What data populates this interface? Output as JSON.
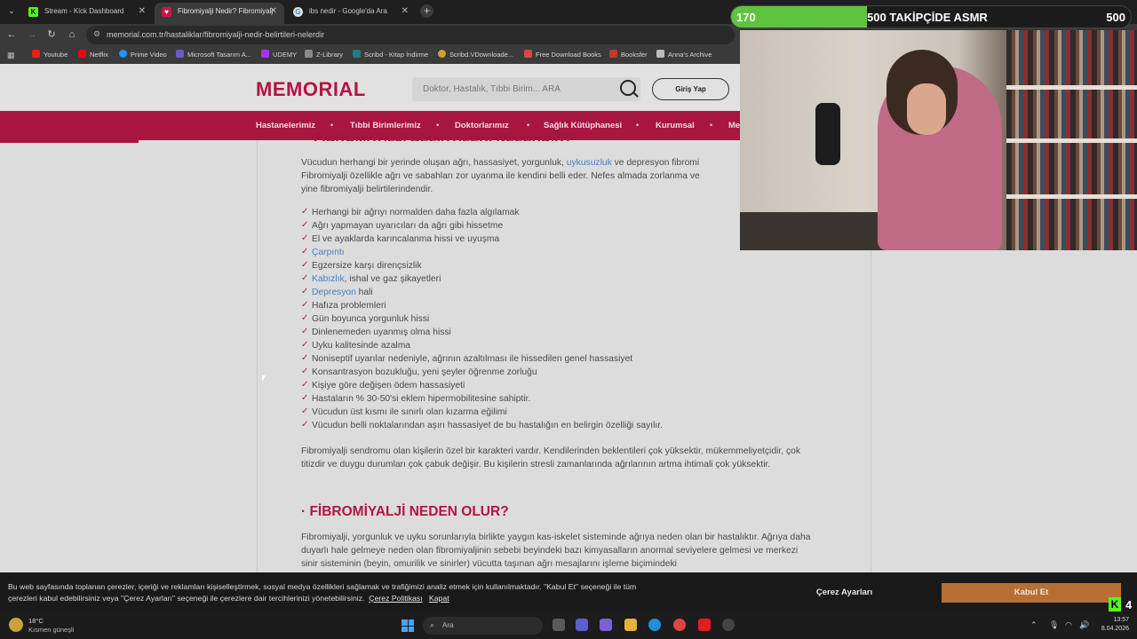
{
  "browser": {
    "tabs": [
      {
        "title": "Stream - Kick Dashboard",
        "favicon": "kick-icon",
        "color": "#53fc18",
        "active": false
      },
      {
        "title": "Fibromiyalji Nedir? Fibromiyalj",
        "favicon": "memorial-icon",
        "color": "#c8174a",
        "active": true
      },
      {
        "title": "ibs nedir - Google'da Ara",
        "favicon": "google-icon",
        "color": "#e0e0e0",
        "active": false
      }
    ],
    "url": "memorial.com.tr/hastaliklar/fibromiyalji-nedir-belirtileri-nelerdir",
    "bookmarks": [
      {
        "label": "Youtube",
        "color": "#e62117"
      },
      {
        "label": "Netflix",
        "color": "#e50914"
      },
      {
        "label": "Prime Video",
        "color": "#1a98ff"
      },
      {
        "label": "Microsoft Tasarım A...",
        "color": "#6a5acd"
      },
      {
        "label": "UDEMY",
        "color": "#a435f0"
      },
      {
        "label": "Z-Library",
        "color": "#888888"
      },
      {
        "label": "Scribd - Kitap İndirme",
        "color": "#1e7b85"
      },
      {
        "label": "Scribd.VDownloade...",
        "color": "#d0a030"
      },
      {
        "label": "Free Download Books",
        "color": "#d44"
      },
      {
        "label": "Booksfer",
        "color": "#c0392b"
      },
      {
        "label": "Anna's Archive",
        "color": "#bbbbbb"
      }
    ]
  },
  "site": {
    "logo": "MEMORIAL",
    "search_placeholder": "Doktor, Hastalık, Tıbbi Birim... ARA",
    "login": "Giriş Yap",
    "brand_color": "#b31544",
    "nav": [
      "Hastanelerimiz",
      "Tıbbi Birimlerimiz",
      "Doktorlarımız",
      "Sağlık Kütüphanesi",
      "Kurumsal",
      "Me"
    ],
    "cut_heading": "· FİBROMİYALJİ BELİRTİLERİ NELERDİR?",
    "intro": {
      "before_link": "Vücudun herhangi bir yerinde oluşan ağrı, hassasiyet, yorgunluk, ",
      "link": "uykusuzluk",
      "after_link": " ve depresyon fibromi",
      "line2": "Fibromiyalji özellikle ağrı ve sabahları zor uyanma ile kendini belli eder. Nefes almada zorlanma ve",
      "line3": "yine fibromiyalji belirtilerindendir."
    },
    "symptoms": [
      {
        "text": "Herhangi bir ağrıyı normalden daha fazla algılamak",
        "link": "",
        "rest": ""
      },
      {
        "text": "Ağrı yapmayan uyarıcıları da ağrı gibi hissetme",
        "link": "",
        "rest": ""
      },
      {
        "text": "El ve ayaklarda karıncalanma hissi ve uyuşma",
        "link": "",
        "rest": ""
      },
      {
        "text": "",
        "link": "Çarpıntı",
        "rest": ""
      },
      {
        "text": "Egzersize karşı dirençsizlik",
        "link": "",
        "rest": ""
      },
      {
        "text": "",
        "link": "Kabızlık",
        "rest": ", ishal ve gaz şikayetleri"
      },
      {
        "text": "",
        "link": "Depresyon",
        "rest": " hali"
      },
      {
        "text": "Hafıza problemleri",
        "link": "",
        "rest": ""
      },
      {
        "text": "Gün boyunca yorgunluk hissi",
        "link": "",
        "rest": ""
      },
      {
        "text": "Dinlenemeden uyanmış olma hissi",
        "link": "",
        "rest": ""
      },
      {
        "text": "Uyku kalitesinde azalma",
        "link": "",
        "rest": ""
      },
      {
        "text": "Noniseptif uyarılar nedeniyle, ağrının azaltılması ile hissedilen genel hassasiyet",
        "link": "",
        "rest": ""
      },
      {
        "text": "Konsantrasyon bozukluğu, yeni şeyler öğrenme zorluğu",
        "link": "",
        "rest": ""
      },
      {
        "text": "Kişiye göre değişen ödem hassasiyeti",
        "link": "",
        "rest": ""
      },
      {
        "text": "Hastaların % 30-50'si eklem hipermobilitesine sahiptir.",
        "link": "",
        "rest": ""
      },
      {
        "text": "Vücudun üst kısmı ile sınırlı olan kızarma eğilimi",
        "link": "",
        "rest": ""
      },
      {
        "text": "Vücudun belli noktalarından aşırı hassasiyet de bu hastalığın en belirgin özelliği sayılır.",
        "link": "",
        "rest": ""
      }
    ],
    "character_para": "Fibromiyalji sendromu olan kişilerin özel bir karakteri vardır. Kendilerinden beklentileri çok yüksektir, mükemmeliyetçidir, çok titizdir ve duygu durumları çok çabuk değişir. Bu kişilerin stresli zamanlarında ağrılarının artma ihtimali çok yüksektir.",
    "heading2": "· FİBROMİYALJİ NEDEN OLUR?",
    "cause_para": "Fibromiyalji, yorgunluk ve uyku sorunlarıyla birlikte yaygın kas-iskelet sisteminde ağrıya neden olan bir hastalıktır. Ağrıya daha duyarlı hale gelmeye neden olan fibromiyaljinin sebebi beyindeki bazı kimyasalların anormal seviyelere gelmesi ve merkezi sinir sisteminin (beyin, omurilik ve sinirler) vücutta taşınan ağrı mesajlarını işleme biçimindeki"
  },
  "cookie": {
    "text_line1": "Bu web sayfasında toplanan çerezler, içeriği ve reklamları kişiselleştirmek, sosyal medya özellikleri sağlamak ve trafiğimizi analiz etmek için kullanılmaktadır. \"Kabul Et\" seçeneği ile tüm",
    "text_line2": "çerezleri kabul edebilirsiniz veya \"Çerez Ayarları\" seçeneği ile çerezlere dair tercihlerinizi yönetebilirsiniz.",
    "policy_link": "Çerez Politikası",
    "close_link": "Kapat",
    "settings": "Çerez Ayarları",
    "accept": "Kabul Et"
  },
  "overlay": {
    "current": "170",
    "title": "500 TAKİPÇİDE ASMR",
    "goal": "500",
    "progress": 0.34,
    "kick_count": "4"
  },
  "taskbar": {
    "temperature": "18°C",
    "weather": "Kısmen güneşli",
    "search": "Ara",
    "time": "13:57",
    "date": "8.04.2026"
  }
}
